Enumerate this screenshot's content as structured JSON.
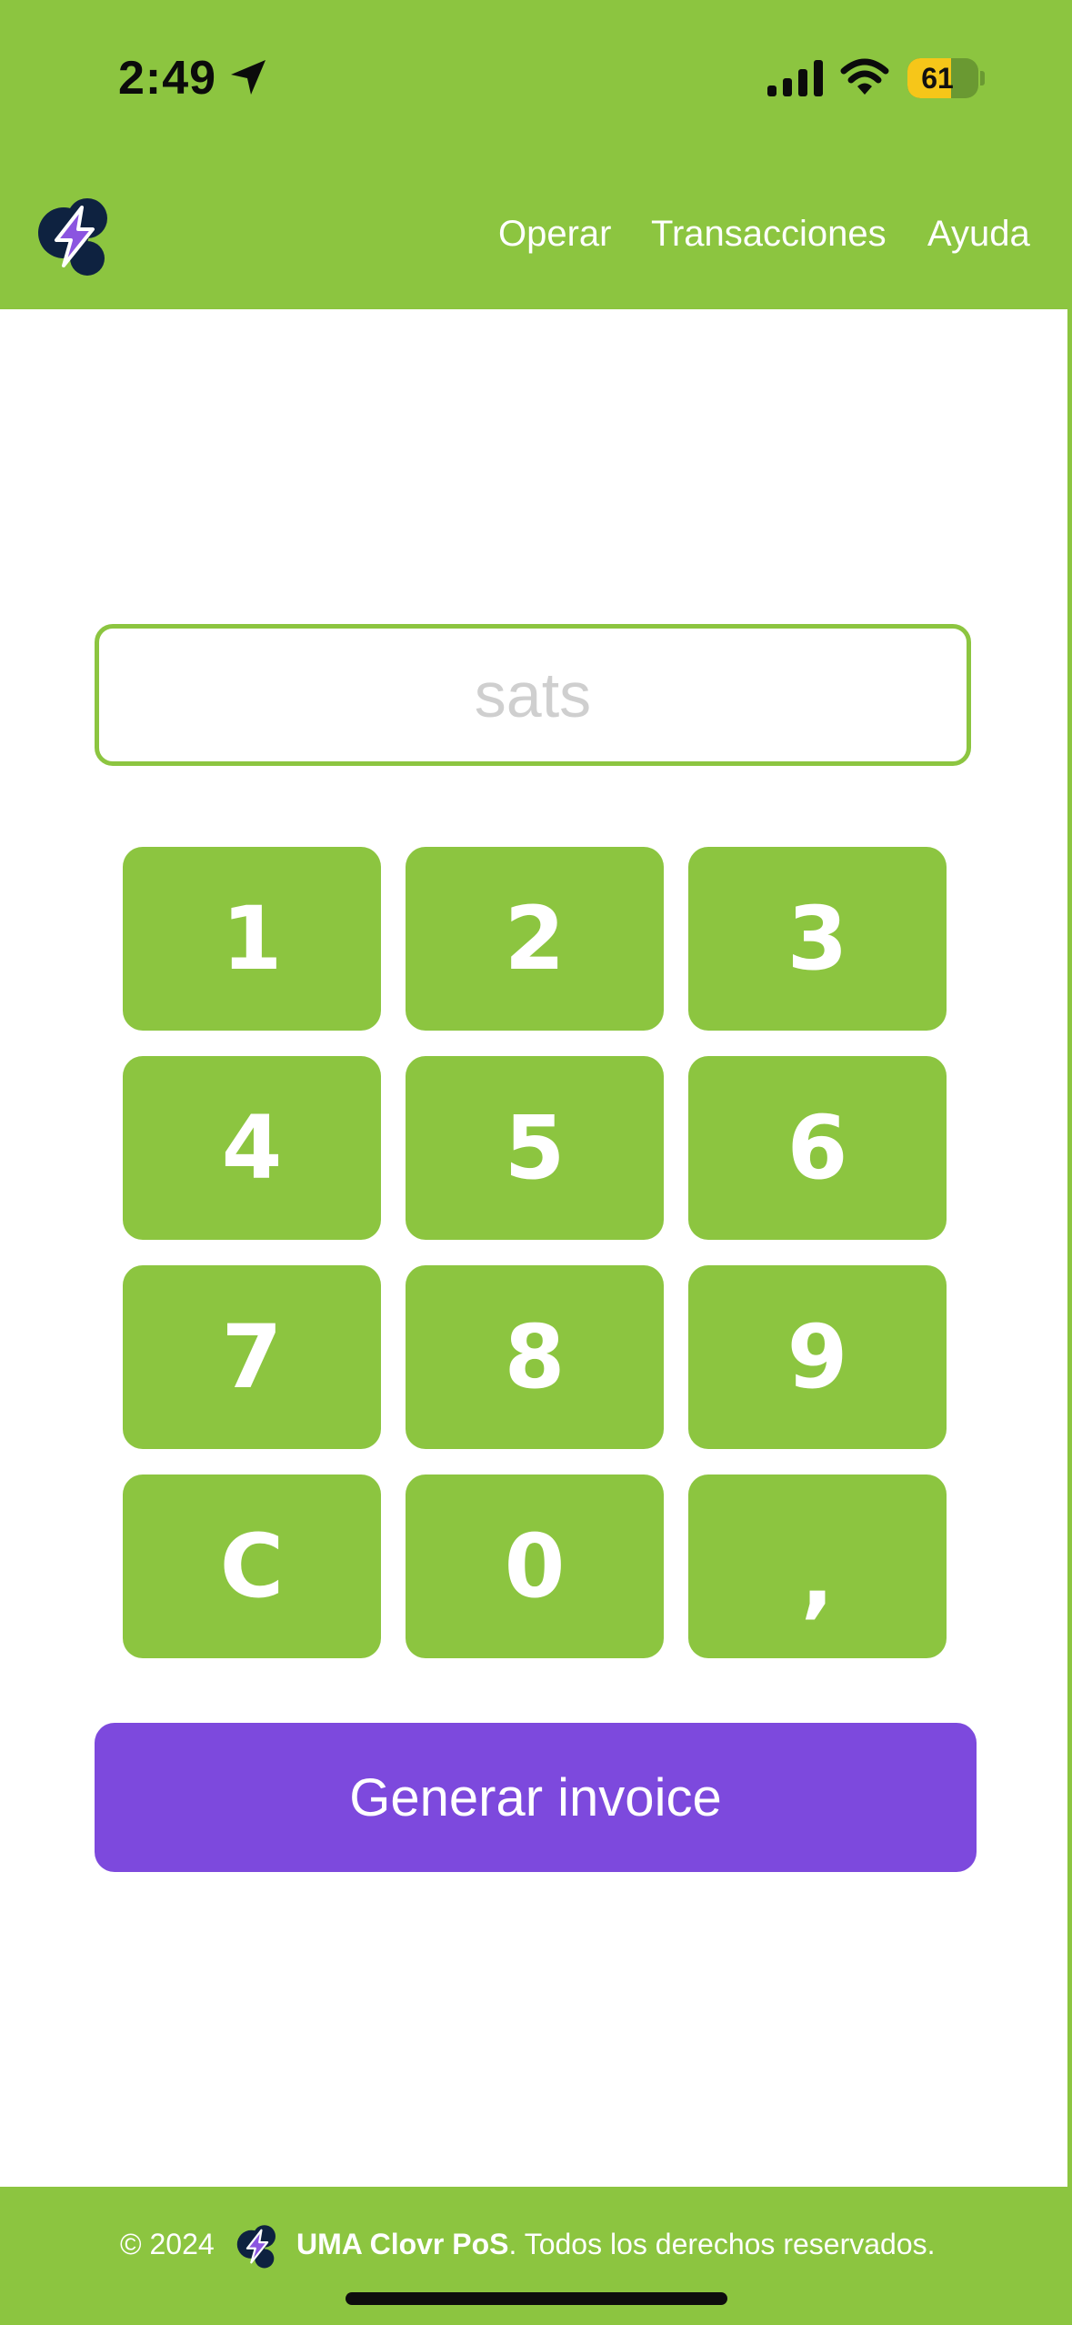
{
  "status_bar": {
    "time": "2:49",
    "battery_level": "61",
    "battery_fraction": 0.61,
    "icons": [
      "location-arrow-icon",
      "cellular-signal-icon",
      "wifi-icon",
      "battery-icon"
    ]
  },
  "header": {
    "logo": "lightning-bolt-logo",
    "nav": [
      "Operar",
      "Transacciones",
      "Ayuda"
    ]
  },
  "amount": {
    "value": "",
    "placeholder": "sats"
  },
  "keypad": {
    "keys": [
      "1",
      "2",
      "3",
      "4",
      "5",
      "6",
      "7",
      "8",
      "9",
      "C",
      "0",
      ","
    ]
  },
  "generate_button": "Generar invoice",
  "footer": {
    "copyright": "© 2024",
    "brand": "UMA Clovr PoS",
    "rights": ". Todos los derechos reservados."
  },
  "colors": {
    "primary_green": "#8cc540",
    "action_purple": "#7d49dd",
    "battery_yellow": "#f6c619",
    "logo_navy": "#0e2240",
    "logo_bolt": "#8b55e0"
  }
}
